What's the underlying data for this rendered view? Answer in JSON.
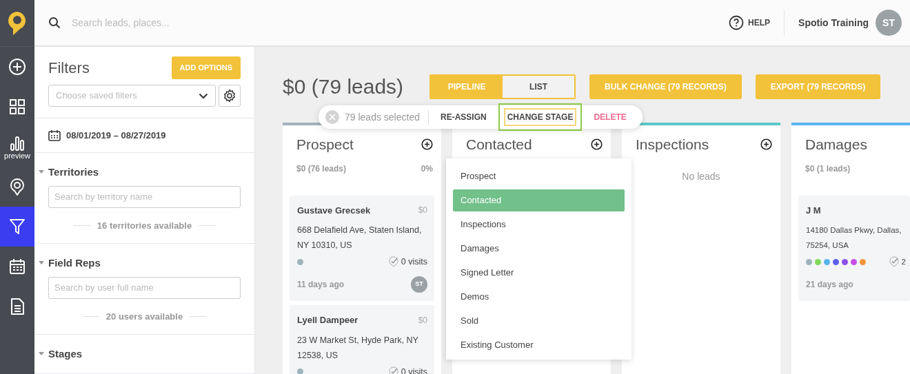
{
  "sidebar": {
    "items": [
      {
        "kind": "add",
        "selected": false
      },
      {
        "kind": "dashboard",
        "selected": false
      },
      {
        "kind": "chart",
        "label": "preview",
        "selected": false
      },
      {
        "kind": "map",
        "selected": false
      },
      {
        "kind": "filter",
        "selected": true
      },
      {
        "kind": "calendar",
        "selected": false
      },
      {
        "kind": "document",
        "selected": false
      }
    ]
  },
  "search": {
    "placeholder": "Search leads, places..."
  },
  "header": {
    "help": "HELP",
    "user": "Spotio Training",
    "avatar": "ST"
  },
  "filters": {
    "title": "Filters",
    "add_button": "ADD OPTIONS",
    "saved_filters": {
      "placeholder": "Choose saved filters"
    },
    "date_range": "08/01/2019 – 08/27/2019",
    "sections": [
      {
        "title": "Territories",
        "expanded": true,
        "search_placeholder": "Search by territory name",
        "available": "16 territories available"
      },
      {
        "title": "Field Reps",
        "expanded": true,
        "search_placeholder": "Search by user full name",
        "available": "20 users available"
      },
      {
        "title": "Stages",
        "expanded": true
      }
    ]
  },
  "summary": "$0 (79 leads)",
  "view_toggle": [
    {
      "label": "PIPELINE",
      "selected": true
    },
    {
      "label": "LIST",
      "selected": false
    }
  ],
  "actions": [
    "BULK CHANGE (79 RECORDS)",
    "EXPORT (79 RECORDS)"
  ],
  "columns": [
    {
      "title": "Prospect",
      "color": "#9fb3bb",
      "total": "$0 (76 leads)",
      "percent": "0%",
      "leads": [
        {
          "name": "Gustave Grecsek",
          "value": "$0",
          "address_lines": [
            "668 Delafield Ave, Staten Island,",
            "NY 10310, US"
          ],
          "tags": [
            {
              "color": "#9fb3bb"
            }
          ],
          "visits": "0 visits",
          "age": "11 days ago",
          "avatar": "ST"
        },
        {
          "name": "Lyell Dampeer",
          "value": "$0",
          "address_lines": [
            "23 W Market St, Hyde Park, NY",
            "12538, US"
          ],
          "tags": [
            {
              "color": "#9fb3bb"
            }
          ],
          "visits": "0 visits"
        }
      ]
    },
    {
      "title": "Contacted"
    },
    {
      "title": "Inspections",
      "color": "#5bc8c8",
      "empty_text": "No leads"
    },
    {
      "title": "Damages",
      "color": "#5ab4ee",
      "total": "$0 (1 leads)",
      "leads": [
        {
          "name": "J M",
          "address_lines": [
            "14180 Dallas Pkwy, Dallas,",
            "75254, USA"
          ],
          "tags": [
            {
              "color": "#9fb3bb"
            },
            {
              "color": "#7ed957"
            },
            {
              "color": "#5ab4ee"
            },
            {
              "color": "#5b5fe8"
            },
            {
              "color": "#8c52e8"
            },
            {
              "color": "#c94fe8"
            },
            {
              "color": "#f0963a"
            }
          ],
          "visits": "2",
          "age": "21 days ago"
        }
      ]
    }
  ],
  "selection_bar": {
    "count": "79 leads selected",
    "actions": [
      {
        "label": "RE-ASSIGN",
        "kind": "normal",
        "selected": false
      },
      {
        "label": "CHANGE STAGE",
        "kind": "normal",
        "selected": true
      },
      {
        "label": "DELETE",
        "kind": "danger",
        "selected": false
      }
    ]
  },
  "stage_menu": {
    "items": [
      {
        "label": "Prospect",
        "selected": false
      },
      {
        "label": "Contacted",
        "selected": true
      },
      {
        "label": "Inspections",
        "selected": false
      },
      {
        "label": "Damages",
        "selected": false
      },
      {
        "label": "Signed Letter",
        "selected": false
      },
      {
        "label": "Demos",
        "selected": false
      },
      {
        "label": "Sold",
        "selected": false
      },
      {
        "label": "Existing Customer",
        "selected": false
      }
    ]
  }
}
